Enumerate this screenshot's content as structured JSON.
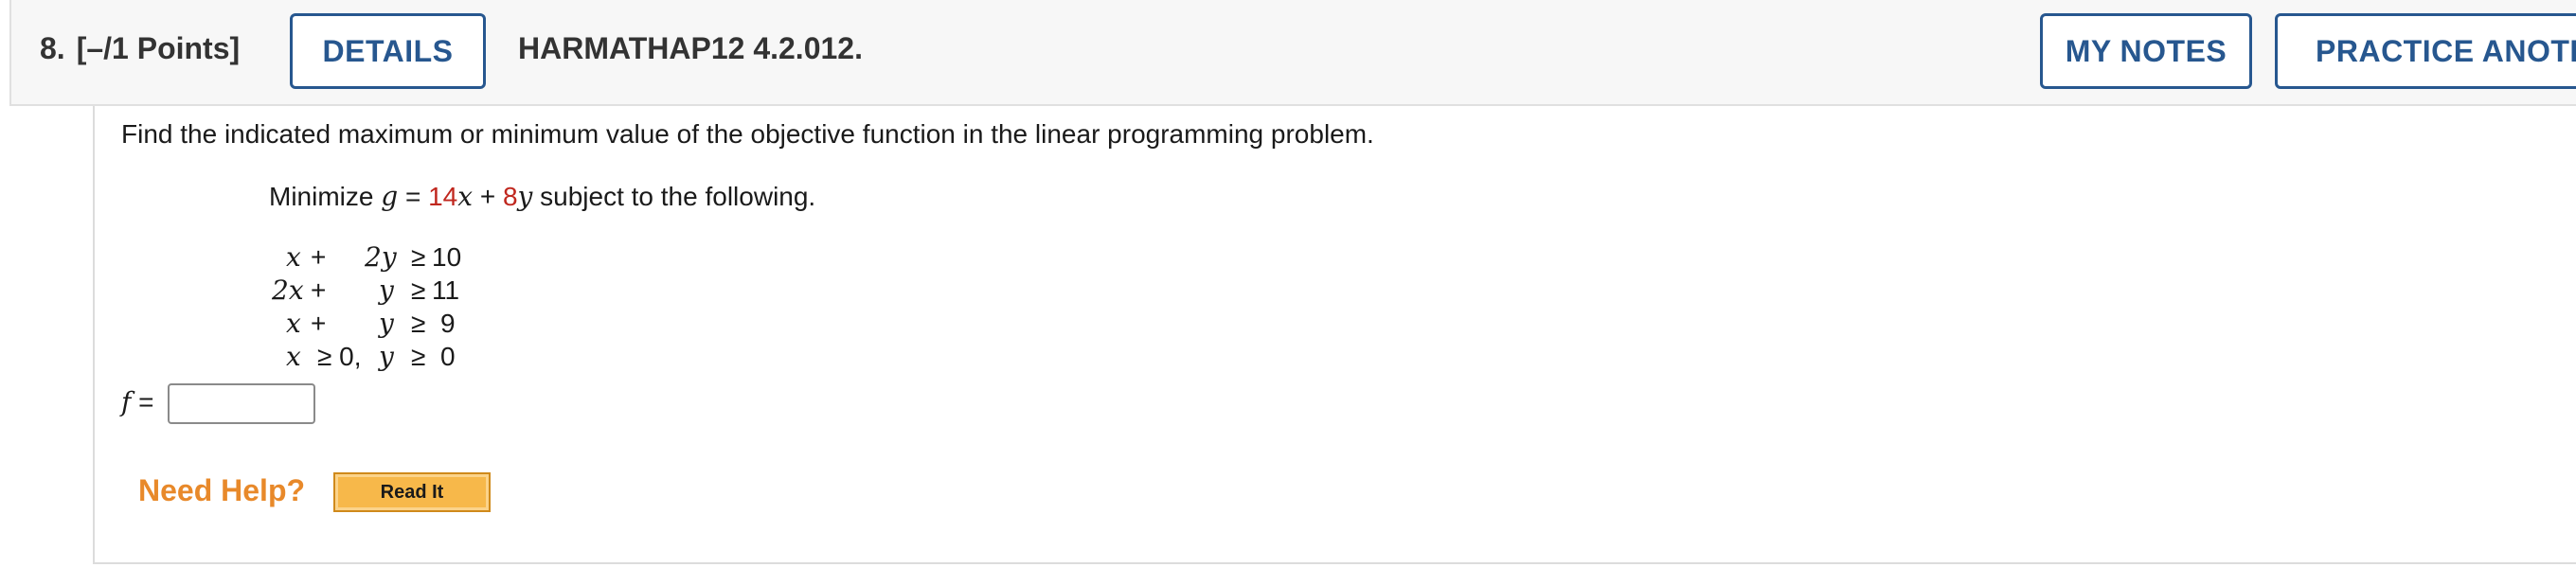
{
  "header": {
    "question_number": "8.",
    "points": "[–/1 Points]",
    "details_label": "DETAILS",
    "problem_code": "HARMATHAP12 4.2.012.",
    "my_notes_label": "MY NOTES",
    "practice_label": "PRACTICE ANOTHE"
  },
  "problem": {
    "prompt": "Find the indicated maximum or minimum value of the objective function in the linear programming problem.",
    "objective_prefix": "Minimize ",
    "objective_var": "g",
    "objective_eq": " = ",
    "coef_x": "14",
    "var_x": "x",
    "plus": " + ",
    "coef_y": "8",
    "var_y": "y",
    "objective_suffix": " subject to the following.",
    "constraints": [
      {
        "a": "x",
        "op": "+",
        "b": "2y",
        "rel": "≥",
        "rhs": "10"
      },
      {
        "a": "2x",
        "op": "+",
        "b": "y",
        "rel": "≥",
        "rhs": "11"
      },
      {
        "a": "x",
        "op": "+",
        "b": "y",
        "rel": "≥",
        "rhs": "9"
      },
      {
        "a": "x",
        "nonneg": "≥ 0, ",
        "b": "y",
        "rel": "≥",
        "rhs": "0"
      }
    ]
  },
  "answer": {
    "label_var": "f",
    "label_eq": " =",
    "value": ""
  },
  "help": {
    "label": "Need Help?",
    "read_it_label": "Read It"
  },
  "colors": {
    "accent": "#27578f",
    "coefficient": "#c0271e",
    "help": "#e8892a",
    "read_it_bg": "#f7b84a"
  }
}
